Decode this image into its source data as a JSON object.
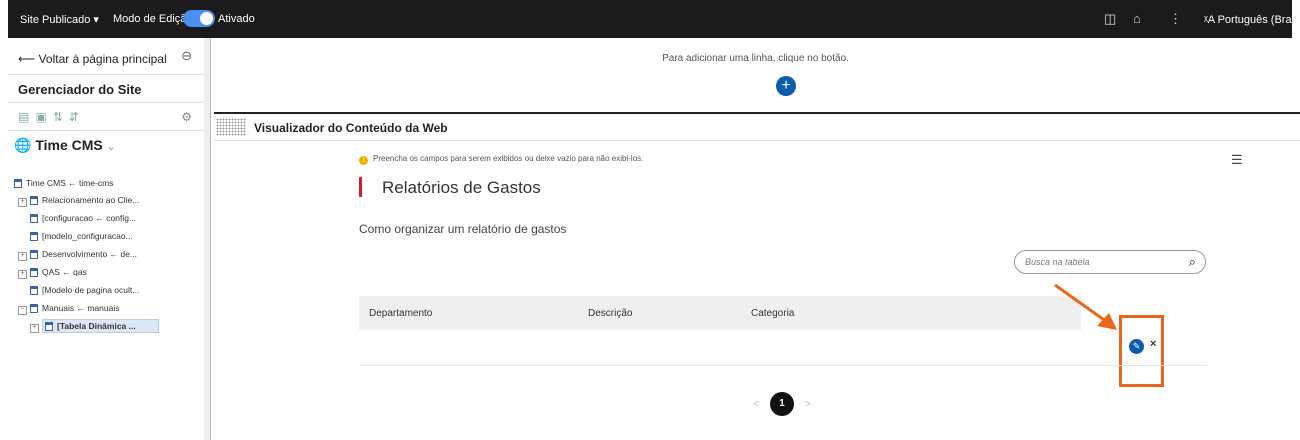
{
  "topbar": {
    "site_status": "Site Publicado",
    "edit_mode_label": "Modo de Edição:",
    "edit_mode_state": "Ativado",
    "language": "Português (Brasil)",
    "colors": {
      "background": "#1b1b1b",
      "toggle": "#4a8ff2"
    }
  },
  "sidebar": {
    "back_label": "Voltar à página principal",
    "title": "Gerenciador do Site",
    "site_name": "Time CMS",
    "tree": [
      {
        "label": "Time CMS ← time-cms"
      },
      {
        "label": "Relacionamento ao Clie..."
      },
      {
        "label": "[configuracao ← config..."
      },
      {
        "label": "[modelo_configuracao..."
      },
      {
        "label": "Desenvolvimento ← de..."
      },
      {
        "label": "QAS ← qas"
      },
      {
        "label": "[Modelo de pagina ocult..."
      },
      {
        "label": "Manuais ← manuais"
      },
      {
        "label": "[Tabela Dinâmica ..."
      }
    ]
  },
  "main": {
    "add_row_hint": "Para adicionar uma linha, clique no botão.",
    "add_button": "+",
    "portlet_title": "Visualizador do Conteúdo da Web",
    "info_text": "Preencha os campos para serem exibidos ou deixe vazio para não exibi-los.",
    "content_title": "Relatórios de Gastos",
    "content_subtitle": "Como organizar um relatório de gastos",
    "search_placeholder": "Busca na tabela",
    "table_headers": [
      "Departamento",
      "Descrição",
      "Categoria"
    ],
    "row_actions": {
      "close": "×"
    },
    "pagination": {
      "current": "1",
      "prev": "<",
      "next": ">"
    },
    "colors": {
      "accent": "#0b5cad",
      "title_bar": "#d0202a",
      "highlight": "#e8671c"
    }
  }
}
